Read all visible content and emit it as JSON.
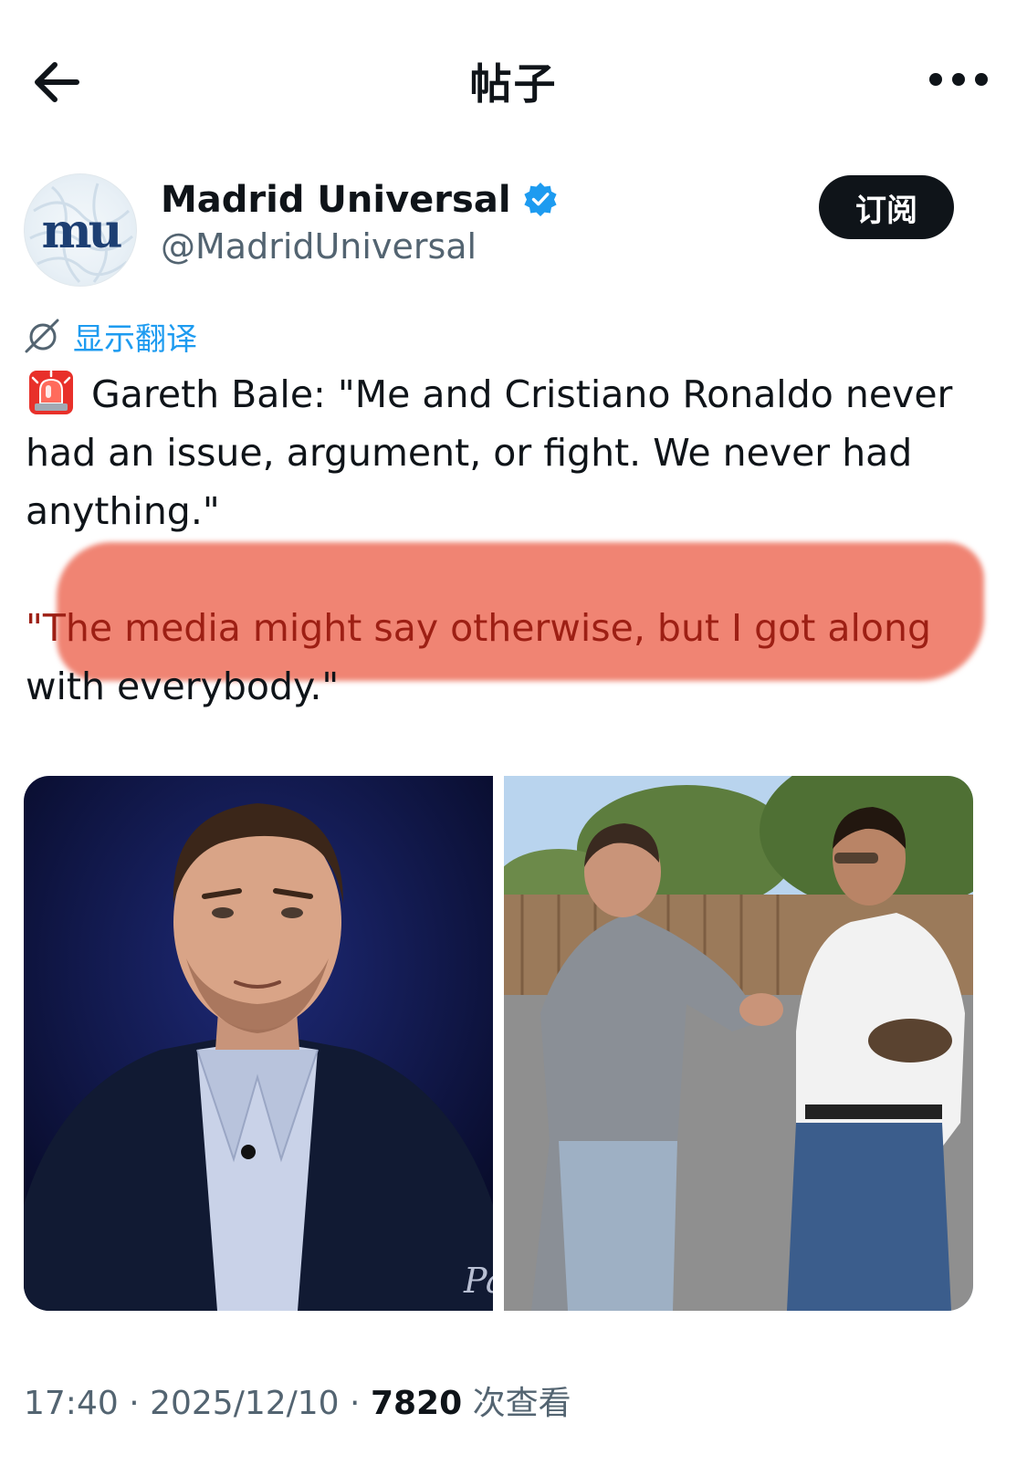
{
  "header": {
    "title": "帖子",
    "back_icon": "arrow-left-icon",
    "more_icon": "more-horizontal-icon"
  },
  "author": {
    "name": "Madrid Universal",
    "handle": "@MadridUniversal",
    "avatar_text": "mu",
    "verified": true,
    "verified_color": "#1d9bf0"
  },
  "actions": {
    "subscribe_label": "订阅"
  },
  "translate": {
    "label": "显示翻译",
    "icon": "translate-icon",
    "color": "#1d9bf0"
  },
  "post": {
    "alert_icon": "rotating-light-emoji",
    "para1": "Gareth Bale: \"Me and Cristiano Ronaldo never had an issue, argument, or fight. We never had anything.\"",
    "para2_highlight": "\"The media might say otherwise, but I got along",
    "para2_rest": "with everybody.\"",
    "highlight_color": "#ec624c"
  },
  "media": [
    {
      "name": "photo-bale-portrait",
      "watermark": "Pa"
    },
    {
      "name": "photo-bale-ronaldo-handshake"
    }
  ],
  "meta": {
    "time": "17:40",
    "date": "2025/12/10",
    "views": "7820",
    "views_label": "次查看"
  }
}
